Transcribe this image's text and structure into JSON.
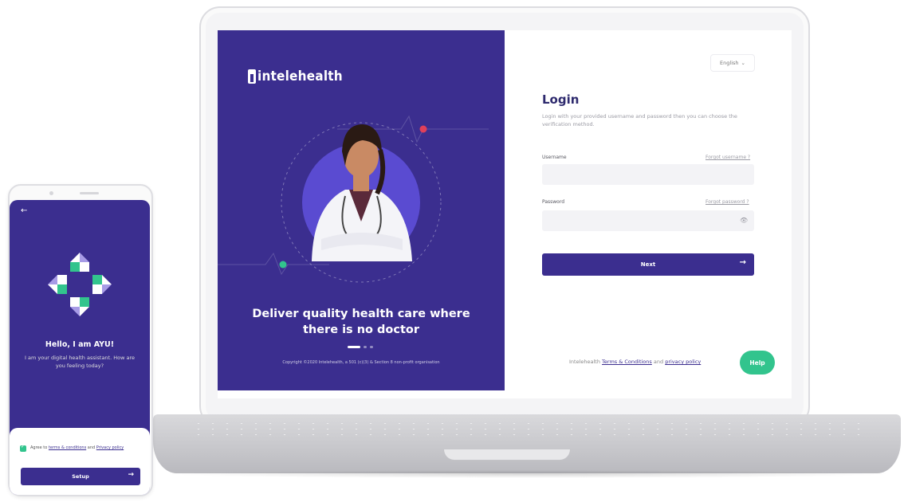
{
  "laptop": {
    "hero": {
      "brand": "intelehealth",
      "title": "Deliver quality health care where there is no doctor",
      "copyright": "Copyright ©2020 Intelehealth, a 501 (c)(3) & Section 8 non-profit organisation"
    },
    "login": {
      "language": "English",
      "title": "Login",
      "subtitle": "Login with your provided username and password then you can choose the verification method.",
      "username_label": "Username",
      "forgot_username": "Forgot username ?",
      "password_label": "Password",
      "forgot_password": "Forgot password ?",
      "next_label": "Next",
      "footer_prefix": "Intelehealth",
      "terms_label": "Terms & Conditions",
      "footer_and": "and",
      "privacy_label": "privacy policy",
      "help_label": "Help"
    }
  },
  "phone": {
    "hello": "Hello, I am AYU!",
    "description": "I am your digital health assistant. How are you feeling today?",
    "agree_prefix": "Agree to",
    "terms_label": "terms & conditions",
    "agree_and": "and",
    "privacy_label": "Privacy policy",
    "setup_label": "Setup"
  },
  "colors": {
    "brand_purple": "#3b2e8f",
    "accent_green": "#32c48d",
    "accent_red": "#e0405a"
  }
}
